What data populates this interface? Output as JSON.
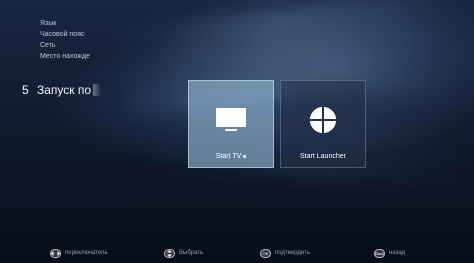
{
  "menu": {
    "items": [
      {
        "label": "Язык"
      },
      {
        "label": "Часовой пояс"
      },
      {
        "label": "Сеть"
      },
      {
        "label": "Место нахожде"
      }
    ]
  },
  "section": {
    "number": "5",
    "title": "Запуск по"
  },
  "tiles": [
    {
      "label": "Start TV",
      "icon": "tv-icon",
      "selected": true
    },
    {
      "label": "Start Launcher",
      "icon": "launcher-grid-icon",
      "selected": false
    }
  ],
  "hints": [
    {
      "icon": "left-right-arrows-icon",
      "label": "переключатель"
    },
    {
      "icon": "up-down-arrows-icon",
      "label": "Выбрать"
    },
    {
      "icon": "ok-button-icon",
      "icon_text": "OK",
      "label": "подтвердить"
    },
    {
      "icon": "back-button-icon",
      "icon_text": "Back",
      "label": "назад"
    }
  ],
  "colors": {
    "background_top": "#182842",
    "background_bottom": "#070d18",
    "selected_tile": "#96b9d7",
    "text_primary": "#ffffff"
  }
}
